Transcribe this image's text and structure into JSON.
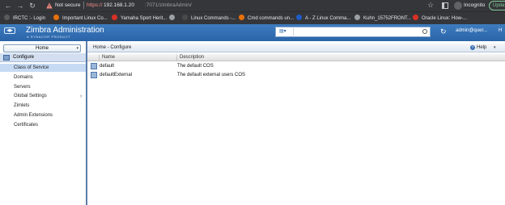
{
  "browser": {
    "security_label": "Not secure",
    "url_scheme": "https://",
    "url_host": "192.168.1.20",
    "url_path": ":7071/zimbraAdmin/",
    "incognito_label": "Incognito",
    "update_label": "Upda"
  },
  "bookmarks": [
    {
      "label": "IRCTC :- Login",
      "icon_color": "#5a5a5a"
    },
    {
      "label": "Important Linux Co...",
      "icon_color": "#e8710a"
    },
    {
      "label": "Yamaha Sport Herit...",
      "icon_color": "#d93025"
    },
    {
      "label": "",
      "icon_color": "#9aa0a6"
    },
    {
      "label": "Linux Commands -...",
      "icon_color": "#4a4a4a"
    },
    {
      "label": "Cmd commands un...",
      "icon_color": "#e8710a"
    },
    {
      "label": "A - Z Linux Comma...",
      "icon_color": "#1e5cc8"
    },
    {
      "label": "Kuhn_15752FRONT...",
      "icon_color": "#9aa0a6"
    },
    {
      "label": "Oracle Linux: How-...",
      "icon_color": "#d93025"
    }
  ],
  "header": {
    "collapse_label": "◀▶",
    "title": "Zimbra Administration",
    "subtitle": "A SYNACOR PRODUCT",
    "search_placeholder": "",
    "refresh_icon": "refresh-icon",
    "user": "admin@quer...",
    "help_short": "H"
  },
  "sidebar": {
    "home_label": "Home",
    "section_label": "Configure",
    "items": [
      {
        "label": "Class of Service",
        "selected": true
      },
      {
        "label": "Domains",
        "selected": false
      },
      {
        "label": "Servers",
        "selected": false
      },
      {
        "label": "Global Settings",
        "selected": false,
        "has_submenu": true
      },
      {
        "label": "Zimlets",
        "selected": false
      },
      {
        "label": "Admin Extensions",
        "selected": false
      },
      {
        "label": "Certificates",
        "selected": false
      }
    ]
  },
  "main": {
    "breadcrumb": "Home - Configure",
    "help_label": "Help",
    "columns": {
      "name": "Name",
      "description": "Description"
    },
    "rows": [
      {
        "name": "default",
        "description": "The default COS"
      },
      {
        "name": "defaultExternal",
        "description": "The default external users COS"
      }
    ]
  }
}
